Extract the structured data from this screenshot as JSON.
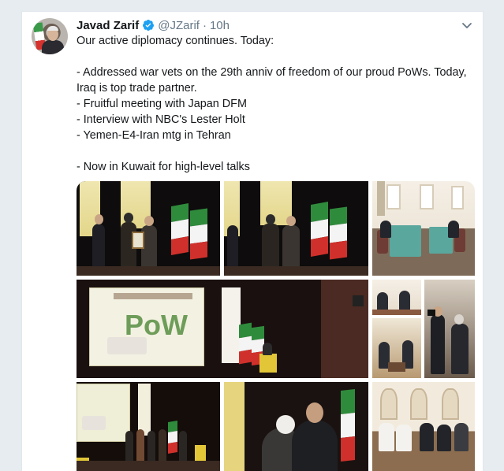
{
  "tweet": {
    "author_name": "Javad Zarif",
    "handle": "@JZarif",
    "separator": "·",
    "time": "10h",
    "lines": [
      "Our active diplomacy continues. Today:",
      "",
      "- Addressed war vets on the 29th anniv of freedom of our proud PoWs. Today, Iraq is top trade partner.",
      "- Fruitful meeting with Japan DFM",
      "- Interview with NBC's Lester Holt",
      "- Yemen-E4-Iran mtg in Tehran",
      "",
      "- Now in Kuwait for high-level talks"
    ],
    "icons": {
      "verified": "verified-badge-icon",
      "menu": "chevron-down-icon"
    },
    "colors": {
      "verified": "#1da1f2",
      "secondary_text": "#657786",
      "background": "#e6ecf0"
    },
    "media": {
      "banner_text": "PoW"
    }
  }
}
